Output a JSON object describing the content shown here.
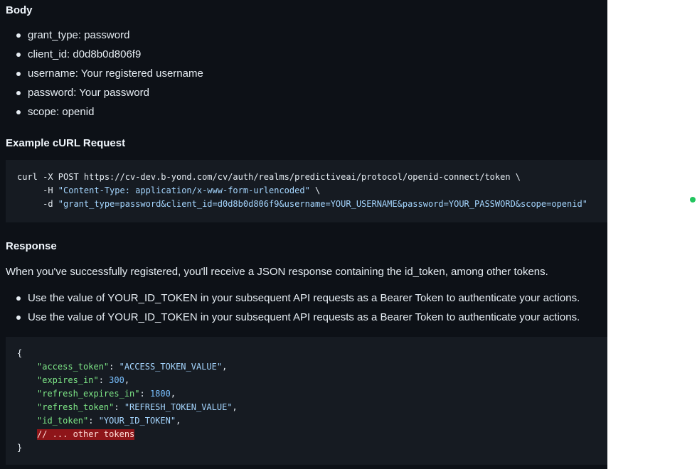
{
  "body_section": {
    "heading": "Body",
    "items": [
      "grant_type: password",
      "client_id: d0d8b0d806f9",
      "username: Your registered username",
      "password: Your password",
      "scope: openid"
    ]
  },
  "curl_section": {
    "heading": "Example cURL Request",
    "lines": [
      {
        "prefix": "curl -X POST https://cv-dev.b-yond.com/cv/auth/realms/predictiveai/protocol/openid-connect/token \\",
        "str": "",
        "suffix": ""
      },
      {
        "prefix": "     -H ",
        "str": "\"Content-Type: application/x-www-form-urlencoded\"",
        "suffix": " \\"
      },
      {
        "prefix": "     -d ",
        "str": "\"grant_type=password&client_id=d0d8b0d806f9&username=YOUR_USERNAME&password=YOUR_PASSWORD&scope=openid\"",
        "suffix": ""
      }
    ]
  },
  "response_section": {
    "heading": "Response",
    "intro": "When you've successfully registered, you'll receive a JSON response containing the id_token, among other tokens.",
    "bullets": [
      "Use the value of YOUR_ID_TOKEN in your subsequent API requests as a Bearer Token to authenticate your actions.",
      "Use the value of YOUR_ID_TOKEN in your subsequent API requests as a Bearer Token to authenticate your actions."
    ]
  },
  "json_example": {
    "open": "{",
    "close": "}",
    "entries": [
      {
        "key": "\"access_token\"",
        "value": "\"ACCESS_TOKEN_VALUE\"",
        "kind": "str"
      },
      {
        "key": "\"expires_in\"",
        "value": "300",
        "kind": "num"
      },
      {
        "key": "\"refresh_expires_in\"",
        "value": "1800",
        "kind": "num"
      },
      {
        "key": "\"refresh_token\"",
        "value": "\"REFRESH_TOKEN_VALUE\"",
        "kind": "str"
      },
      {
        "key": "\"id_token\"",
        "value": "\"YOUR_ID_TOKEN\"",
        "kind": "str"
      }
    ],
    "comment": "// ... other tokens"
  },
  "colors": {
    "background": "#0d1117",
    "code_background": "#161b22",
    "string": "#a5d6ff",
    "key": "#7ee787",
    "number": "#79c0ff",
    "error_highlight": "#8e1519",
    "status_dot": "#22c55e"
  }
}
